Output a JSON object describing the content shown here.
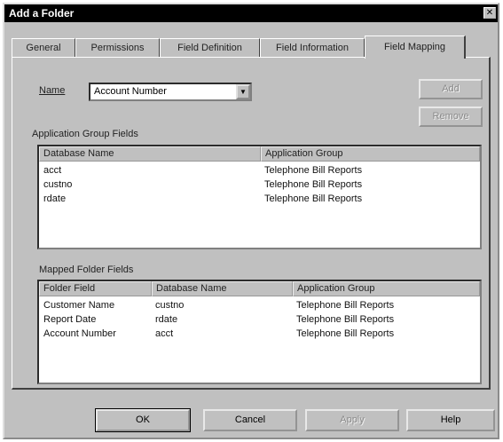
{
  "window": {
    "title": "Add a Folder",
    "close_glyph": "✕"
  },
  "tabs": [
    {
      "label": "General",
      "active": false
    },
    {
      "label": "Permissions",
      "active": false
    },
    {
      "label": "Field Definition",
      "active": false
    },
    {
      "label": "Field Information",
      "active": false
    },
    {
      "label": "Field Mapping",
      "active": true
    }
  ],
  "name_field": {
    "label": "Name",
    "value": "Account Number",
    "arrow_glyph": "▼"
  },
  "side_buttons": {
    "add": "Add",
    "remove": "Remove"
  },
  "application_group_fields": {
    "label": "Application Group Fields",
    "columns": [
      "Database Name",
      "Application Group"
    ],
    "rows": [
      [
        "acct",
        "Telephone Bill Reports"
      ],
      [
        "custno",
        "Telephone Bill Reports"
      ],
      [
        "rdate",
        "Telephone Bill Reports"
      ]
    ]
  },
  "mapped_folder_fields": {
    "label": "Mapped Folder Fields",
    "columns": [
      "Folder Field",
      "Database Name",
      "Application Group"
    ],
    "rows": [
      [
        "Customer Name",
        "custno",
        "Telephone Bill Reports"
      ],
      [
        "Report Date",
        "rdate",
        "Telephone Bill Reports"
      ],
      [
        "Account Number",
        "acct",
        "Telephone Bill Reports"
      ]
    ]
  },
  "footer_buttons": {
    "ok": "OK",
    "cancel": "Cancel",
    "apply": "Apply",
    "help": "Help"
  }
}
